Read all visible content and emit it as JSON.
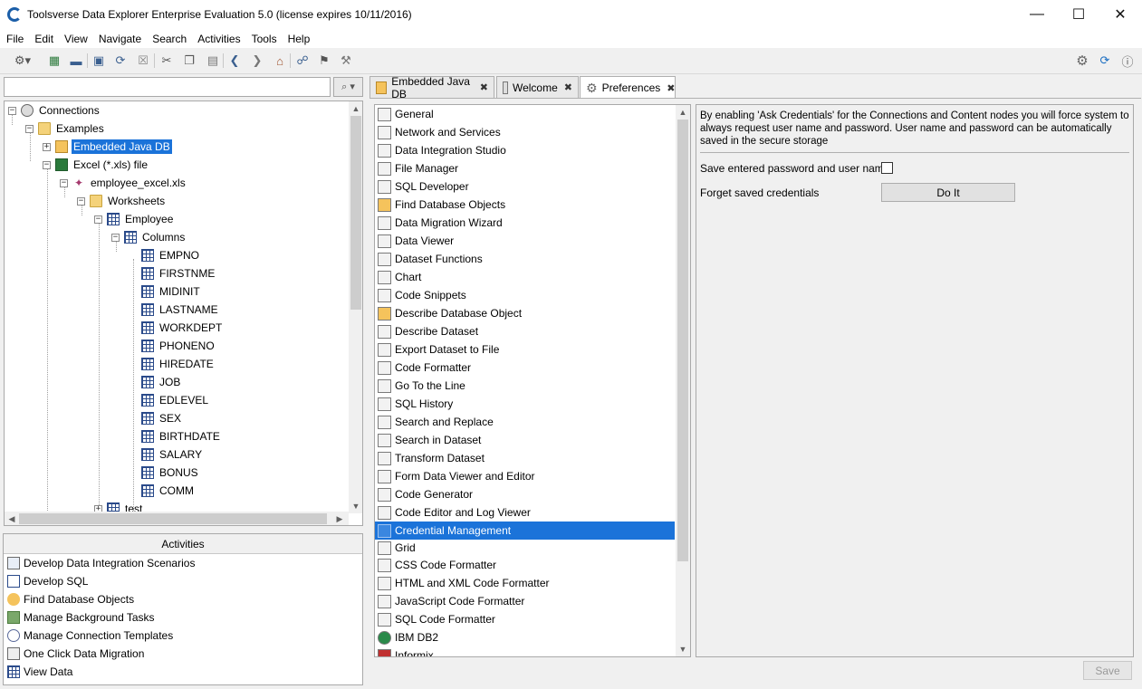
{
  "window": {
    "title": "Toolsverse Data Explorer Enterprise Evaluation 5.0 (license expires 10/11/2016)",
    "minimize": "—",
    "maximize": "☐",
    "close": "✕"
  },
  "menu": [
    "File",
    "Edit",
    "View",
    "Navigate",
    "Search",
    "Activities",
    "Tools",
    "Help"
  ],
  "toolbar": {
    "icons": [
      "connect-icon",
      "add-icon",
      "remove-icon",
      "properties-icon",
      "refresh-icon",
      "stop-icon",
      "cut-icon",
      "copy-icon",
      "paste-icon",
      "back-icon",
      "forward-icon",
      "home-icon",
      "network-icon",
      "sign-icon",
      "tasks-icon"
    ],
    "right_icons": [
      "gear-icon",
      "update-icon",
      "help-icon"
    ]
  },
  "search": {
    "value": "",
    "button_glyph": "⌕ ▾"
  },
  "tree": {
    "root": "Connections",
    "examples": "Examples",
    "embedded": "Embedded Java DB",
    "excel": "Excel (*.xls) file",
    "excel_file": "employee_excel.xls",
    "worksheets": "Worksheets",
    "employee": "Employee",
    "columns_label": "Columns",
    "columns": [
      "EMPNO",
      "FIRSTNME",
      "MIDINIT",
      "LASTNAME",
      "WORKDEPT",
      "PHONENO",
      "HIREDATE",
      "JOB",
      "EDLEVEL",
      "SEX",
      "BIRTHDATE",
      "SALARY",
      "BONUS",
      "COMM"
    ],
    "test": "test"
  },
  "activities": {
    "header": "Activities",
    "items": [
      "Develop Data Integration Scenarios",
      "Develop SQL",
      "Find Database Objects",
      "Manage Background Tasks",
      "Manage Connection Templates",
      "One Click Data Migration",
      "View Data"
    ]
  },
  "tabs": [
    {
      "label": "Embedded Java DB",
      "close": "✖"
    },
    {
      "label": "Welcome",
      "close": "✖"
    },
    {
      "label": "Preferences",
      "close": "✖"
    }
  ],
  "preferences": {
    "items": [
      "General",
      "Network and Services",
      "Data Integration Studio",
      "File Manager",
      "SQL Developer",
      "Find Database Objects",
      "Data Migration Wizard",
      "Data Viewer",
      "Dataset Functions",
      "Chart",
      "Code Snippets",
      "Describe Database Object",
      "Describe Dataset",
      "Export Dataset to File",
      "Code Formatter",
      "Go To the Line",
      "SQL History",
      "Search and Replace",
      "Search in Dataset",
      "Transform Dataset",
      "Form Data Viewer and Editor",
      "Code Generator",
      "Code Editor and Log Viewer",
      "Credential Management",
      "Grid",
      "CSS Code Formatter",
      "HTML and XML Code Formatter",
      "JavaScript Code Formatter",
      "SQL Code Formatter",
      "IBM DB2",
      "Informix"
    ],
    "selected_index": 23
  },
  "details": {
    "description": "By enabling 'Ask Credentials' for the Connections and Content nodes you will force system to always request user name and password. User name and password can be automatically saved in the secure storage",
    "save_label": "Save entered password and user name",
    "forget_label": "Forget saved credentials",
    "do_it": "Do It",
    "save_checked": false
  },
  "save_button": "Save",
  "scroll_glyphs": {
    "up": "▲",
    "down": "▼",
    "left": "◀",
    "right": "▶"
  }
}
